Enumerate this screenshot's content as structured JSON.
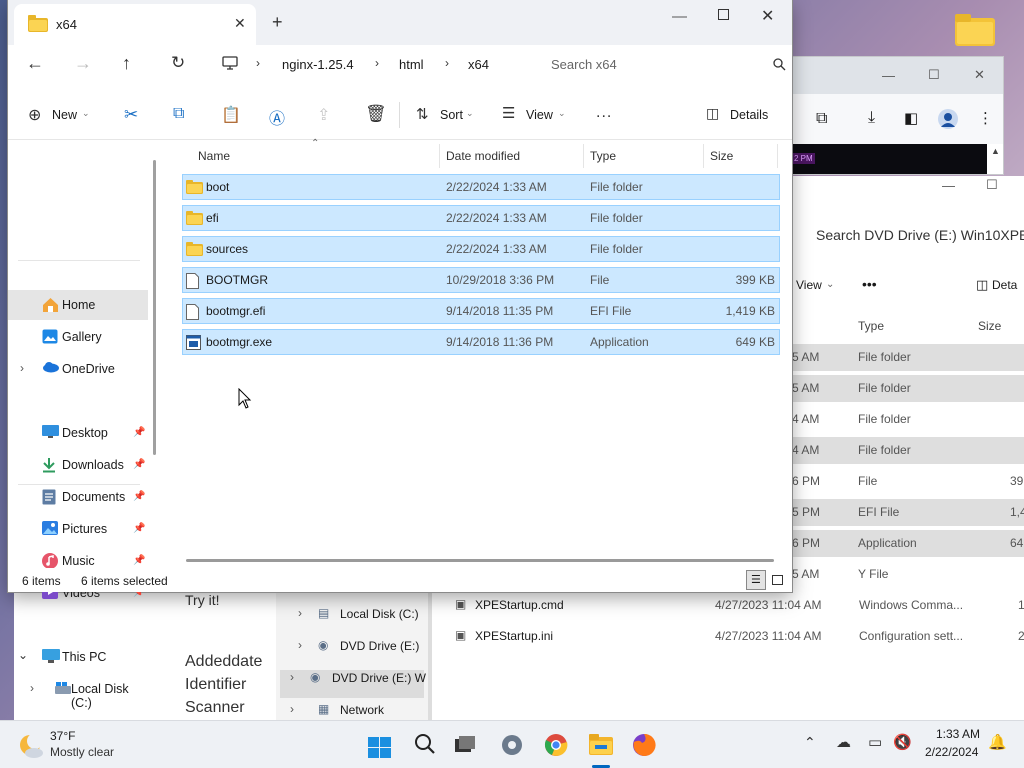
{
  "background": {
    "right_window": {
      "search_text": "Search DVD Drive (E:) Win10XPE_",
      "view_label": "View",
      "details_label": "Deta",
      "col_type": "Type",
      "col_size": "Size",
      "rows": [
        {
          "time": "5 AM",
          "type": "File folder",
          "size": ""
        },
        {
          "time": "5 AM",
          "type": "File folder",
          "size": ""
        },
        {
          "time": "4 AM",
          "type": "File folder",
          "size": ""
        },
        {
          "time": "4 AM",
          "type": "File folder",
          "size": ""
        },
        {
          "time": "6 PM",
          "type": "File",
          "size": "39"
        },
        {
          "time": "5 PM",
          "type": "EFI File",
          "size": "1,41"
        },
        {
          "time": "6 PM",
          "type": "Application",
          "size": "64"
        },
        {
          "time": "5 AM",
          "type": "Y File",
          "size": ""
        }
      ],
      "files": [
        {
          "name": "XPEStartup.cmd",
          "date": "4/27/2023 11:04 AM",
          "type": "Windows Comma...",
          "size": "1"
        },
        {
          "name": "XPEStartup.ini",
          "date": "4/27/2023 11:04 AM",
          "type": "Configuration sett...",
          "size": "2"
        }
      ],
      "nav": [
        {
          "label": "Local Disk (C:)"
        },
        {
          "label": "DVD Drive (E:)"
        },
        {
          "label": "DVD Drive (E:) W"
        },
        {
          "label": "Network"
        }
      ]
    },
    "browser_window": {
      "tag": "2 PM"
    },
    "left_page": {
      "lines": [
        "Try it!",
        "Addeddate",
        "Identifier",
        "Scanner"
      ]
    }
  },
  "window": {
    "tab_title": "x64",
    "breadcrumb": [
      "nginx-1.25.4",
      "html",
      "x64"
    ],
    "search_placeholder": "Search x64",
    "toolbar": {
      "new_label": "New",
      "sort_label": "Sort",
      "view_label": "View",
      "more_label": "...",
      "details_label": "Details"
    },
    "nav_items": [
      {
        "label": "Home",
        "icon": "home-icon",
        "pinned": false
      },
      {
        "label": "Gallery",
        "icon": "gallery-icon",
        "pinned": false
      },
      {
        "label": "OneDrive",
        "icon": "cloud-icon",
        "pinned": false
      },
      {
        "label": "Desktop",
        "icon": "desktop-icon",
        "pinned": true
      },
      {
        "label": "Downloads",
        "icon": "download-icon",
        "pinned": true
      },
      {
        "label": "Documents",
        "icon": "documents-icon",
        "pinned": true
      },
      {
        "label": "Pictures",
        "icon": "pictures-icon",
        "pinned": true
      },
      {
        "label": "Music",
        "icon": "music-icon",
        "pinned": true
      },
      {
        "label": "Videos",
        "icon": "videos-icon",
        "pinned": true
      },
      {
        "label": "This PC",
        "icon": "pc-icon",
        "pinned": false
      },
      {
        "label": "Local Disk (C:)",
        "icon": "disk-icon",
        "pinned": false
      }
    ],
    "columns": {
      "name": "Name",
      "date": "Date modified",
      "type": "Type",
      "size": "Size"
    },
    "files": [
      {
        "name": "boot",
        "date": "2/22/2024 1:33 AM",
        "type": "File folder",
        "size": "",
        "kind": "folder"
      },
      {
        "name": "efi",
        "date": "2/22/2024 1:33 AM",
        "type": "File folder",
        "size": "",
        "kind": "folder"
      },
      {
        "name": "sources",
        "date": "2/22/2024 1:33 AM",
        "type": "File folder",
        "size": "",
        "kind": "folder"
      },
      {
        "name": "BOOTMGR",
        "date": "10/29/2018 3:36 PM",
        "type": "File",
        "size": "399 KB",
        "kind": "file"
      },
      {
        "name": "bootmgr.efi",
        "date": "9/14/2018 11:35 PM",
        "type": "EFI File",
        "size": "1,419 KB",
        "kind": "file"
      },
      {
        "name": "bootmgr.exe",
        "date": "9/14/2018 11:36 PM",
        "type": "Application",
        "size": "649 KB",
        "kind": "app"
      }
    ],
    "status": {
      "count": "6 items",
      "selected": "6 items selected"
    }
  },
  "taskbar": {
    "weather_temp": "37°F",
    "weather_desc": "Mostly clear",
    "time": "1:33 AM",
    "date": "2/22/2024"
  },
  "colors": {
    "selection": "#cce8ff",
    "selection_border": "#99d1ff",
    "folder": "#f8c53a",
    "accent": "#0067c0"
  }
}
